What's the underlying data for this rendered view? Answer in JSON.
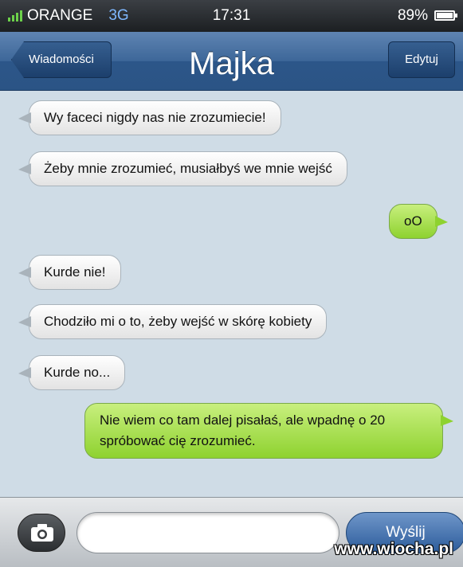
{
  "status_bar": {
    "carrier": "ORANGE",
    "network": "3G",
    "time": "17:31",
    "battery": "89%",
    "battery_level": 0.89
  },
  "nav": {
    "back_label": "Wiadomości",
    "title": "Majka",
    "edit_label": "Edytuj"
  },
  "messages": [
    {
      "direction": "in",
      "text": "Wy faceci nigdy nas nie zrozumiecie!"
    },
    {
      "direction": "in",
      "text": "Żeby mnie zrozumieć, musiałbyś we mnie wejść"
    },
    {
      "direction": "out",
      "text": "oO"
    },
    {
      "direction": "in",
      "text": "Kurde nie!"
    },
    {
      "direction": "in",
      "text": "Chodziło mi o to, żeby wejść w skórę kobiety"
    },
    {
      "direction": "in",
      "text": "Kurde no..."
    },
    {
      "direction": "out",
      "text": "Nie wiem co tam dalej pisałaś, ale wpadnę o 20 spróbować cię zrozumieć."
    }
  ],
  "input": {
    "value": "",
    "send_label": "Wyślij",
    "camera_icon": "camera-icon"
  },
  "watermark": "www.wiocha.pl",
  "colors": {
    "incoming_bubble": "#ffffff",
    "outgoing_bubble": "#8ed22f",
    "nav_bar": "#3d6799"
  }
}
